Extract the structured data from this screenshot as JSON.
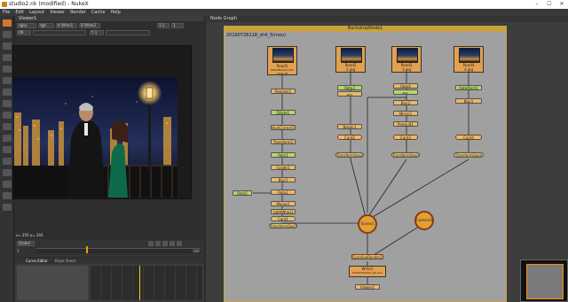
{
  "app": {
    "title": "studio2.nk (modified) - NukeX"
  },
  "menubar": {
    "items": [
      "File",
      "Edit",
      "Layout",
      "Viewer",
      "Render",
      "Cache",
      "Help"
    ]
  },
  "window_controls": [
    "–",
    "☐",
    "✕"
  ],
  "viewer": {
    "tab_label": "Viewer1",
    "channels": "rgba",
    "rgb": "rgb",
    "layer": "A Write1",
    "b_input": "B Write2",
    "gain": "f/8",
    "frame": "1",
    "zoom": "1:1",
    "gamma": "Y 1",
    "coords": "x= 250 y= 344"
  },
  "timeline": {
    "playback": "Global",
    "start": "1",
    "end": "100"
  },
  "curve_tabs": [
    "Curve Editor",
    "Dope Sheet"
  ],
  "node_graph": {
    "tab_label": "Node Graph",
    "backdrop_label": "BackdropNode1",
    "backdrop_date": "20190726118_sh4_5(mov)"
  },
  "nodes": {
    "read1": "Read1",
    "read1_file": "GRADED/shot-06-0041.tif",
    "read2": "Read2",
    "read2_file": "2.jpg",
    "read3": "Read3",
    "read3_file": "3.jpg",
    "read4": "Read4",
    "read4_file": "4.jpg",
    "reorder1": "Reorder1",
    "dilate1": "Dilate1",
    "huecorrect1": "HueCorrect1",
    "transform1": "Transform1",
    "roto1": "Roto1",
    "grade1": "Grade1",
    "blur1a": "Blur1",
    "roto2": "Roto2",
    "merge1": "Merge1",
    "lightwrap1": "LightWrap1",
    "card1": "Card1",
    "transformgeo1": "TransformGeo1",
    "roto3": "Roto3",
    "roto3_sub": "Roto",
    "bezier1": "Bezier1",
    "card2": "Card2",
    "transformgeo2": "TransformGeo2",
    "roto4": "Roto4",
    "roto4_sub": "Roto",
    "blur2": "Blur2",
    "mirror1": "Mirror1",
    "premult1": "Premult1",
    "card3": "Card3",
    "transformgeo3": "TransformGeo3",
    "roto5": "RotoPaint1",
    "blur3": "Blur1",
    "card4": "Card4",
    "transformgeo4": "TransformGeo4",
    "scene1": "Scene1",
    "camera1": "Camera1",
    "scanline": "ScanlineRender1",
    "write1": "Write1",
    "write1_file": "20190000000_stb.mov",
    "viewer1": "Viewer1",
    "roto6": "Roto5"
  },
  "colors": {
    "read": "#e3a14f",
    "dot_green": "#b6d56a",
    "dot_orange": "#e8b867",
    "card": "#e0c070",
    "backdrop": "#a0a0a0",
    "backdrop_title": "#c9a240",
    "circle": "#e2a032"
  }
}
